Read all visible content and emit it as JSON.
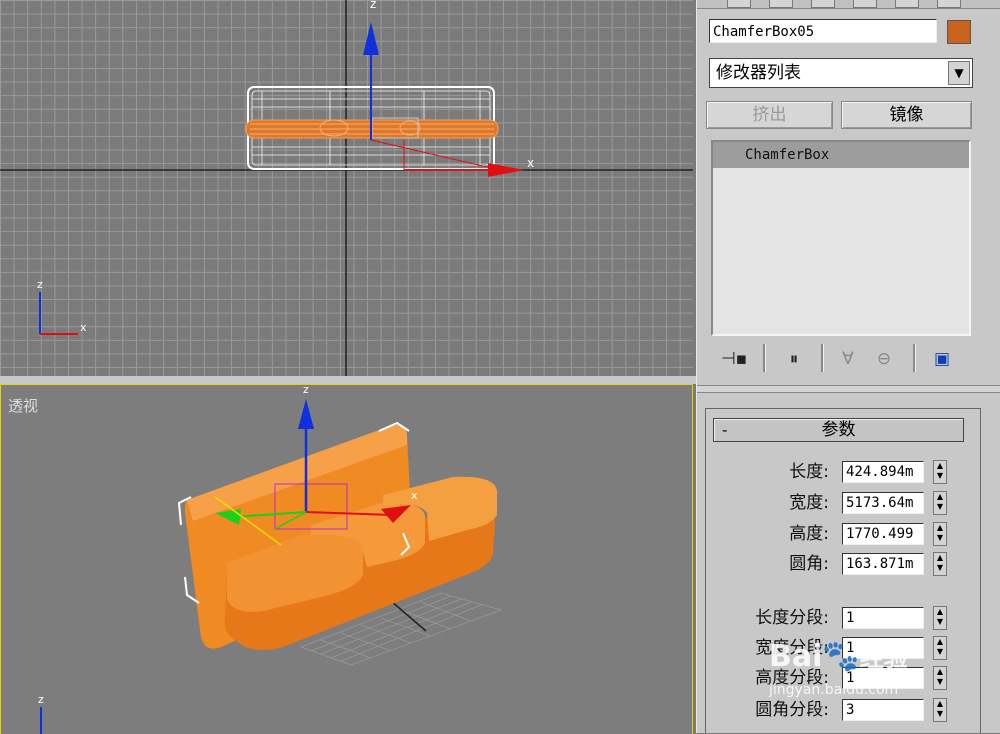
{
  "viewports": {
    "front": {
      "axis_z": "z",
      "axis_x": "x"
    },
    "perspective": {
      "label": "透视",
      "axis_z": "z",
      "axis_x": "x"
    }
  },
  "command_panel": {
    "object_name": "ChamferBox05",
    "object_color": "#c8641e",
    "modifier_list": "修改器列表",
    "buttons": {
      "extrude": "挤出",
      "mirror": "镜像"
    },
    "stack_items": [
      "ChamferBox"
    ],
    "rollout_title": "参数",
    "rollout_collapse": "-",
    "params": [
      {
        "label": "长度:",
        "value": "424.894m"
      },
      {
        "label": "宽度:",
        "value": "5173.64m"
      },
      {
        "label": "高度:",
        "value": "1770.499"
      },
      {
        "label": "圆角:",
        "value": "163.871m"
      }
    ],
    "segments": [
      {
        "label": "长度分段:",
        "value": "1"
      },
      {
        "label": "宽度分段:",
        "value": "1"
      },
      {
        "label": "高度分段:",
        "value": "1"
      },
      {
        "label": "圆角分段:",
        "value": "3"
      }
    ]
  },
  "watermark": {
    "brand": "Bai",
    "brand2": "经验",
    "url": "jingyan.baidu.com"
  }
}
